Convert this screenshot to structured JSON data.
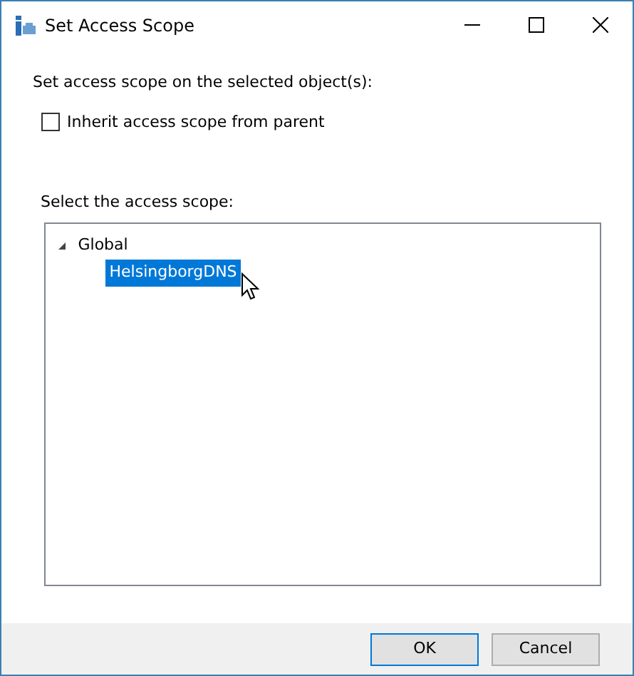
{
  "window": {
    "title": "Set Access Scope"
  },
  "prompt": "Set access scope on the selected object(s):",
  "inherit": {
    "label": "Inherit access scope from parent",
    "checked": false
  },
  "tree_label": "Select the access scope:",
  "tree": [
    {
      "label": "Global",
      "expanded": true,
      "selected": false,
      "children": [
        {
          "label": "HelsingborgDNS",
          "selected": true
        }
      ]
    }
  ],
  "buttons": [
    {
      "label": "OK",
      "default": true
    },
    {
      "label": "Cancel",
      "default": false
    }
  ]
}
